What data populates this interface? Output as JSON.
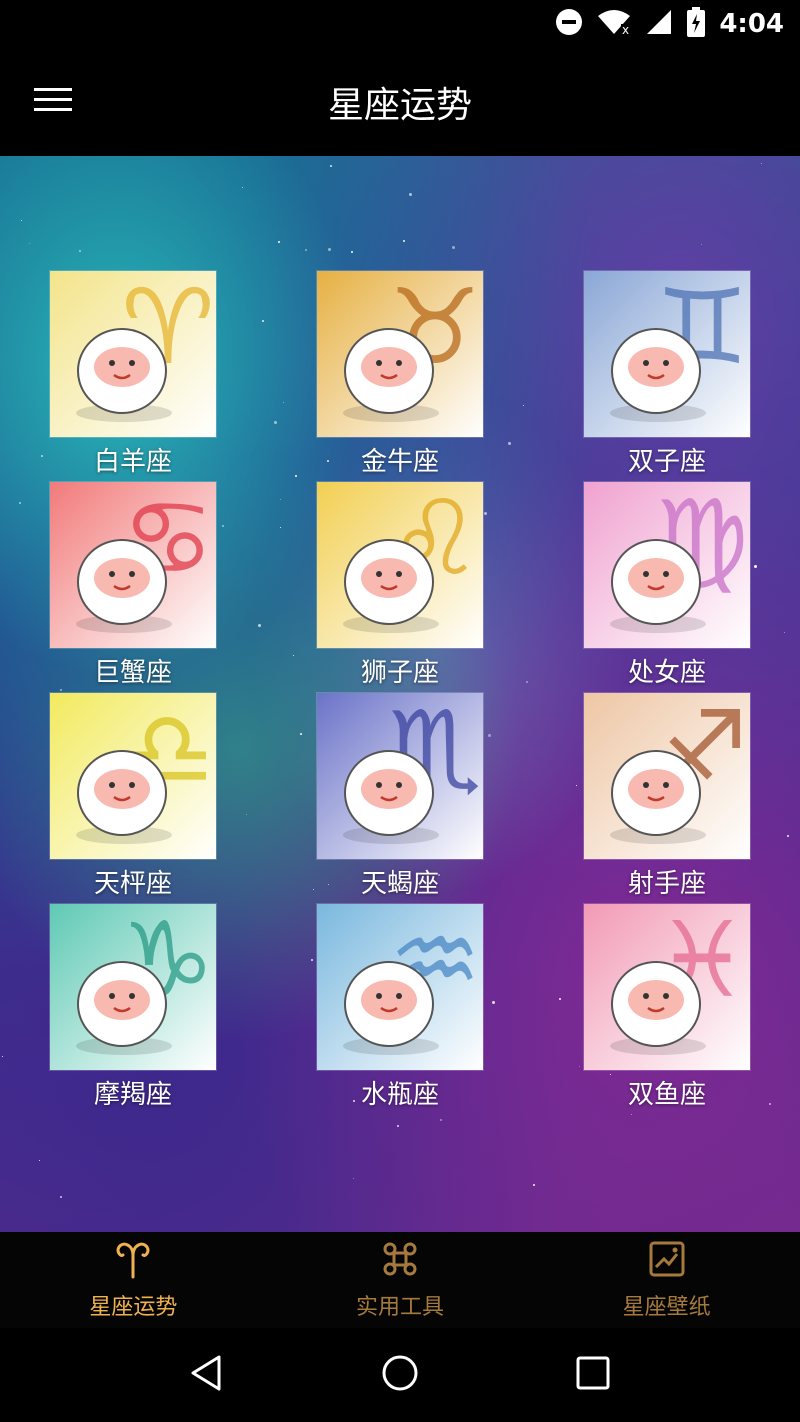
{
  "status_bar": {
    "time": "4:04",
    "icons": [
      "dnd-icon",
      "wifi-icon",
      "signal-icon",
      "battery-icon"
    ]
  },
  "app_bar": {
    "title": "星座运势",
    "menu_icon": "hamburger-menu-icon"
  },
  "signs": [
    {
      "label": "白羊座",
      "glyph": "♈",
      "bg": "#f3e48a",
      "symbol_color": "#e6b530"
    },
    {
      "label": "金牛座",
      "glyph": "♉",
      "bg": "#e6b043",
      "symbol_color": "#b86a1c"
    },
    {
      "label": "双子座",
      "glyph": "♊",
      "bg": "#8aa7d6",
      "symbol_color": "#5073b5"
    },
    {
      "label": "巨蟹座",
      "glyph": "♋",
      "bg": "#f27a7a",
      "symbol_color": "#e03a4a"
    },
    {
      "label": "狮子座",
      "glyph": "♌",
      "bg": "#f2cf52",
      "symbol_color": "#e1a81f"
    },
    {
      "label": "处女座",
      "glyph": "♍",
      "bg": "#f0a2d0",
      "symbol_color": "#c870c8"
    },
    {
      "label": "天枰座",
      "glyph": "♎",
      "bg": "#f2ea5e",
      "symbol_color": "#d9c420"
    },
    {
      "label": "天蝎座",
      "glyph": "♏",
      "bg": "#6b73c8",
      "symbol_color": "#3c44a0"
    },
    {
      "label": "射手座",
      "glyph": "♐",
      "bg": "#eec6a4",
      "symbol_color": "#a4562f"
    },
    {
      "label": "摩羯座",
      "glyph": "♑",
      "bg": "#5fc9b4",
      "symbol_color": "#2a9b87"
    },
    {
      "label": "水瓶座",
      "glyph": "♒",
      "bg": "#7ab8de",
      "symbol_color": "#4a88c6"
    },
    {
      "label": "双鱼座",
      "glyph": "♓",
      "bg": "#f29ab6",
      "symbol_color": "#e56a92"
    }
  ],
  "bottom_nav": [
    {
      "label": "星座运势",
      "icon": "aries-icon",
      "active": true
    },
    {
      "label": "实用工具",
      "icon": "command-icon",
      "active": false
    },
    {
      "label": "星座壁纸",
      "icon": "image-icon",
      "active": false
    }
  ],
  "system_nav": {
    "back": "back-icon",
    "home": "home-icon",
    "recents": "recents-icon"
  },
  "colors": {
    "active": "#f0b24e",
    "inactive": "#a57a3c",
    "app_bar": "#000000"
  }
}
